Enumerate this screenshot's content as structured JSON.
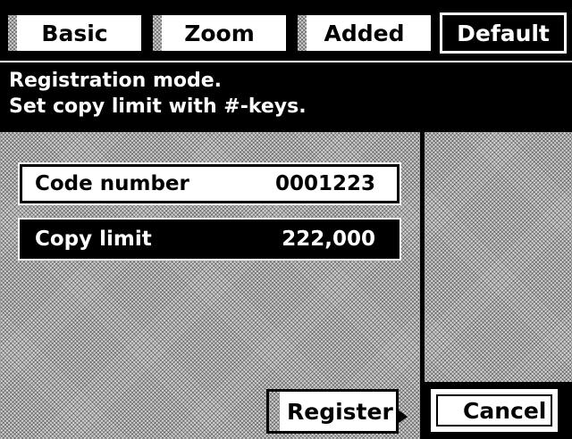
{
  "tabs": [
    {
      "label": "Basic",
      "active": false
    },
    {
      "label": "Zoom",
      "active": false
    },
    {
      "label": "Added",
      "active": false
    },
    {
      "label": "Default",
      "active": true
    }
  ],
  "message": {
    "line1": "Registration mode.",
    "line2": "Set copy limit with #-keys."
  },
  "fields": {
    "code_number": {
      "label": "Code number",
      "value": "0001223"
    },
    "copy_limit": {
      "label": "Copy limit",
      "value": "222,000"
    }
  },
  "buttons": {
    "register": "Register",
    "cancel": "Cancel"
  },
  "colors": {
    "foreground": "#000000",
    "background": "#ffffff",
    "dither": "#d0d0d0"
  }
}
